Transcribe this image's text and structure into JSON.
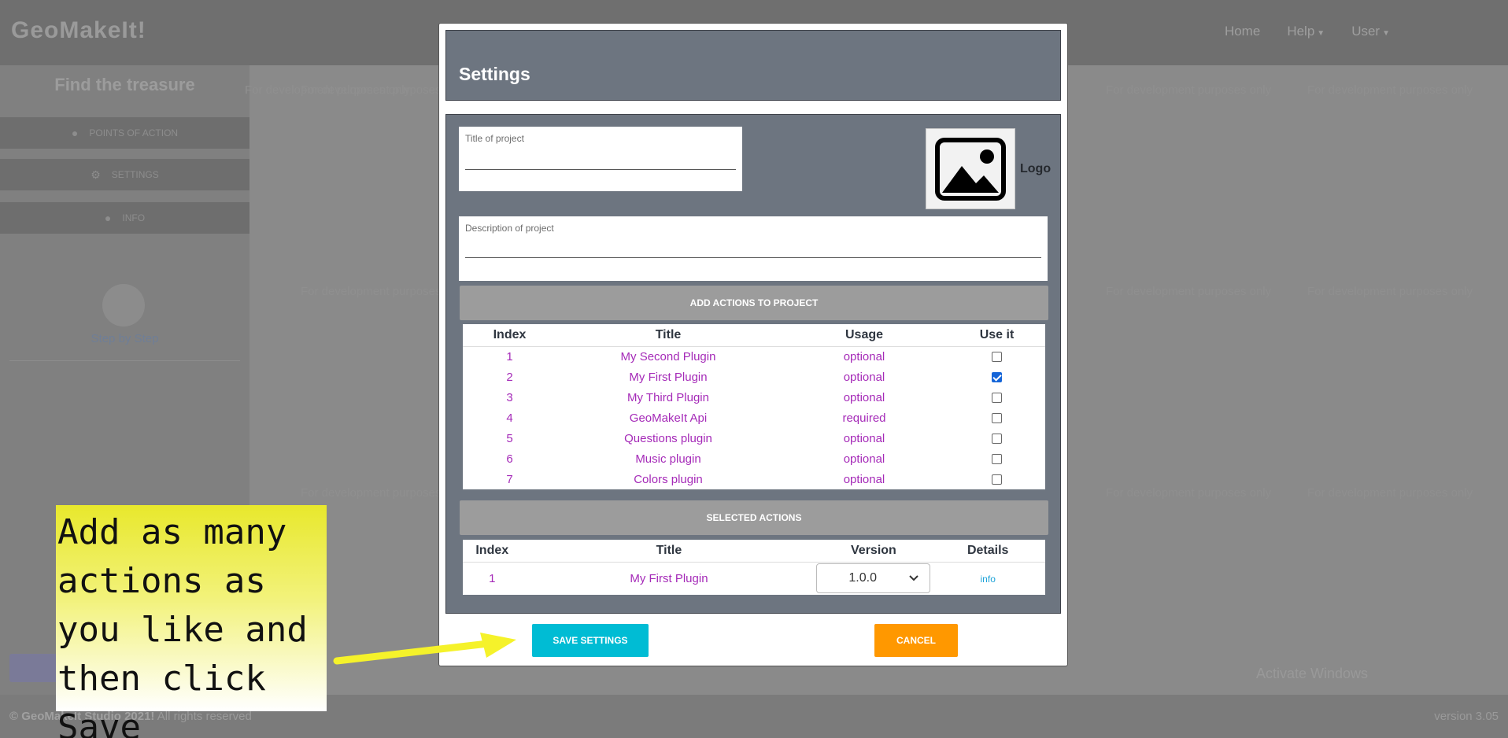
{
  "app": {
    "brand": "GeoMakeIt!",
    "nav": [
      "Home",
      "Help",
      "User"
    ],
    "footer_brand": "© GeoMakeIt Studio 2021!",
    "footer_rights": " All rights reserved",
    "version": "version 3.05",
    "activate": "Activate Windows",
    "map_watermark": "For development purposes only"
  },
  "sidebar": {
    "project_title": "Find the treasure",
    "items": [
      {
        "label": "POINTS OF ACTION",
        "icon": "map-pin-icon"
      },
      {
        "label": "SETTINGS",
        "icon": "gear-icon"
      },
      {
        "label": "INFO",
        "icon": "info-icon"
      }
    ],
    "step_label": "Step by Step"
  },
  "modal": {
    "title": "Settings",
    "title_field_label": "Title of project",
    "title_field_value": "",
    "description_field_label": "Description of project",
    "description_field_value": "",
    "logo_label": "Logo",
    "add_actions_label": "ADD ACTIONS TO PROJECT",
    "selected_actions_label": "SELECTED ACTIONS",
    "save_label": "SAVE SETTINGS",
    "cancel_label": "CANCEL",
    "actions_table": {
      "headers": [
        "Index",
        "Title",
        "Usage",
        "Use it"
      ],
      "rows": [
        {
          "index": "1",
          "title": "My Second Plugin",
          "usage": "optional",
          "checked": false
        },
        {
          "index": "2",
          "title": "My First Plugin",
          "usage": "optional",
          "checked": true
        },
        {
          "index": "3",
          "title": "My Third Plugin",
          "usage": "optional",
          "checked": false
        },
        {
          "index": "4",
          "title": "GeoMakeIt Api",
          "usage": "required",
          "checked": false
        },
        {
          "index": "5",
          "title": "Questions plugin",
          "usage": "optional",
          "checked": false
        },
        {
          "index": "6",
          "title": "Music plugin",
          "usage": "optional",
          "checked": false
        },
        {
          "index": "7",
          "title": "Colors plugin",
          "usage": "optional",
          "checked": false
        }
      ]
    },
    "selected_table": {
      "headers": [
        "Index",
        "Title",
        "Version",
        "Details"
      ],
      "rows": [
        {
          "index": "1",
          "title": "My First Plugin",
          "version": "1.0.0",
          "details": "info"
        }
      ]
    }
  },
  "tutorial": {
    "text": "Add as many actions as you like and then click Save"
  },
  "colors": {
    "modal_header": "#6d7580",
    "save": "#00bcd4",
    "cancel": "#ff9800",
    "link": "#a52ab8",
    "tip_yellow": "#e8e82c"
  }
}
